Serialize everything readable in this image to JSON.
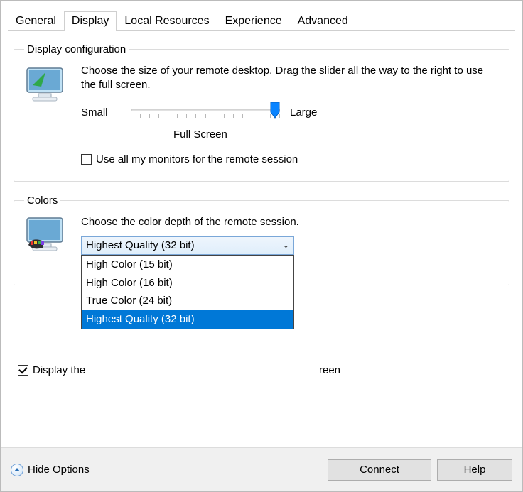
{
  "tabs": {
    "general": "General",
    "display": "Display",
    "local_resources": "Local Resources",
    "experience": "Experience",
    "advanced": "Advanced"
  },
  "display_config": {
    "legend": "Display configuration",
    "description": "Choose the size of your remote desktop. Drag the slider all the way to the right to use the full screen.",
    "slider_small": "Small",
    "slider_large": "Large",
    "slider_value_label": "Full Screen",
    "use_all_monitors": "Use all my monitors for the remote session"
  },
  "colors": {
    "legend": "Colors",
    "description": "Choose the color depth of the remote session.",
    "selected": "Highest Quality (32 bit)",
    "options": [
      "High Color (15 bit)",
      "High Color (16 bit)",
      "True Color (24 bit)",
      "Highest Quality (32 bit)"
    ]
  },
  "connection_bar": {
    "prefix": "Display the",
    "suffix": "reen"
  },
  "bottom": {
    "hide_options": "Hide Options",
    "connect": "Connect",
    "help": "Help"
  }
}
